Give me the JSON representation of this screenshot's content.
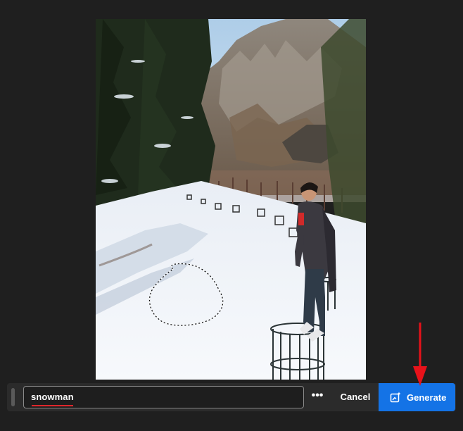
{
  "prompt": {
    "value": "snowman",
    "spellcheck_color": "#e0262c"
  },
  "toolbar": {
    "more_label": "•••",
    "cancel_label": "Cancel",
    "generate_label": "Generate",
    "generate_icon": "generative-fill-icon",
    "accent_color": "#1473e6"
  },
  "canvas": {
    "subject": "snowy park with pine trees, mountains, a young man standing on a metal tree guard",
    "selection": "dashed freeform lasso selection"
  },
  "annotation": {
    "arrow_color": "#e8121a"
  }
}
